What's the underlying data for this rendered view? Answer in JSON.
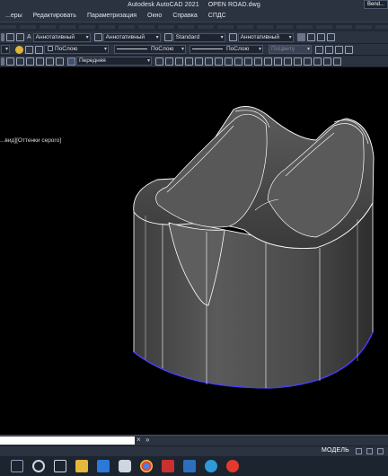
{
  "window": {
    "app_title": "Autodesk AutoCAD 2021",
    "file_name": "OPEN ROAD.dwg",
    "user_badge": "Bend..."
  },
  "menu": {
    "items": [
      "...еры",
      "Редактировать",
      "Параметризация",
      "Окно",
      "Справка",
      "СПДС"
    ]
  },
  "toolbar1": {
    "annotative_1": "Аннотативный",
    "annotative_2": "Аннотативный",
    "style": "Standard",
    "annotative_3": "Аннотативный"
  },
  "toolbar2": {
    "layer_color": "ПоСлою",
    "linetype": "ПоСлою",
    "lineweight": "ПоСлою",
    "plotstyle": "ПоЦвету"
  },
  "toolbar3": {
    "view": "Передняя"
  },
  "viewport": {
    "label": "...вид][Оттенки серого]"
  },
  "statusbar": {
    "model_tab": "МОДЕЛЬ"
  },
  "colors": {
    "chrome_bg": "#2b3240",
    "viewport_bg": "#000000",
    "model_face": "#4a4a4a",
    "edge": "#ffffff",
    "base_edge": "#4a3cff"
  },
  "icons": [
    "windows-start-icon",
    "search-icon",
    "taskview-icon",
    "explorer-icon",
    "mail-icon",
    "store-icon",
    "chrome-icon",
    "yandex-icon",
    "word-icon",
    "autocad-icon",
    "telegram-icon"
  ]
}
